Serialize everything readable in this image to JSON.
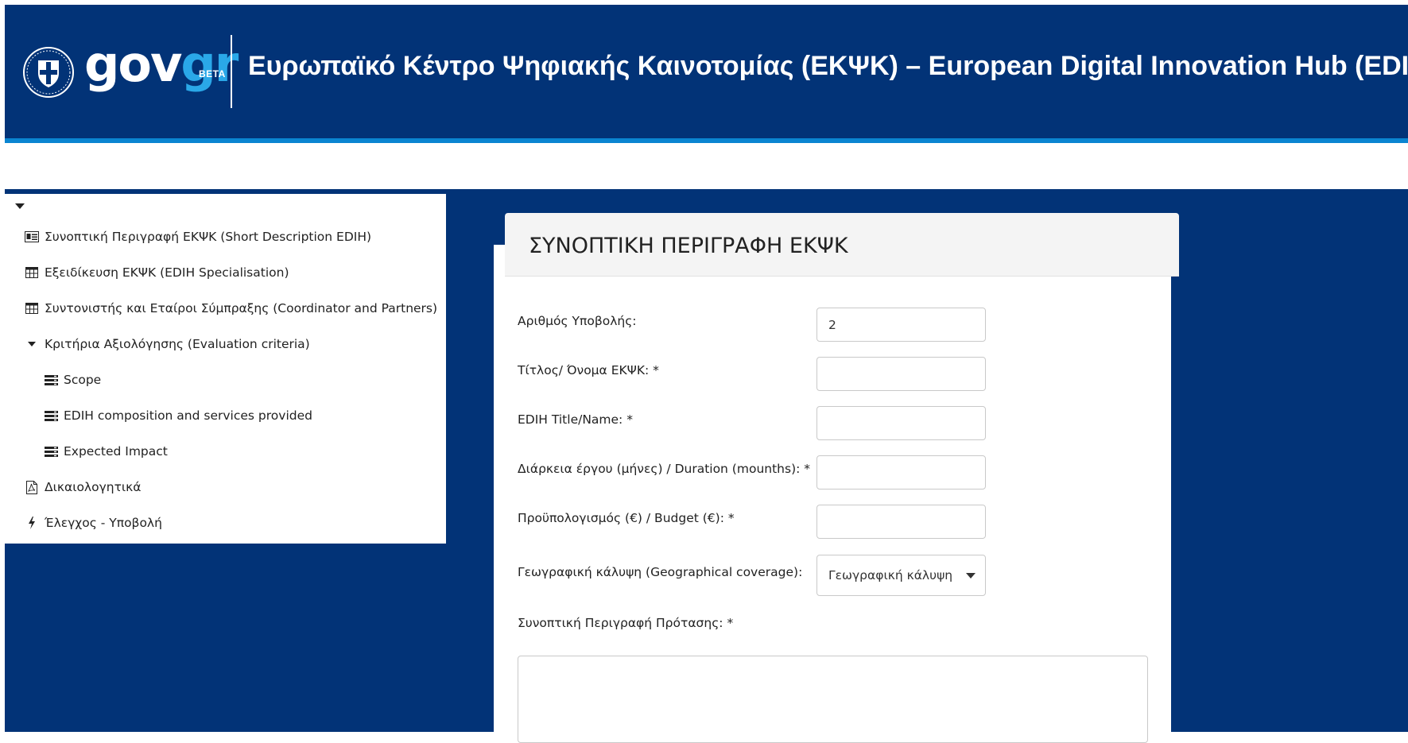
{
  "header": {
    "logo_gov": "gov",
    "logo_gr": "gr",
    "logo_beta": "BETA",
    "title": "Ευρωπαϊκό Κέντρο Ψηφιακής Καινοτομίας (ΕΚΨΚ) – European Digital Innovation Hub (EDIH)",
    "colors": {
      "background": "#023377",
      "accent_line": "#0a85d1",
      "logo_gr": "#2aa8e8"
    }
  },
  "sidebar": {
    "items": [
      {
        "label": "Συνοπτική Περιγραφή ΕΚΨΚ (Short Description EDIH)",
        "icon": "id-card-icon"
      },
      {
        "label": "Εξειδίκευση ΕΚΨΚ (EDIH Specialisation)",
        "icon": "table-icon"
      },
      {
        "label": "Συντονιστής και Εταίροι Σύμπραξης (Coordinator and Partners)",
        "icon": "table-icon"
      },
      {
        "label": "Κριτήρια Αξιολόγησης (Evaluation criteria)",
        "icon": "caret-down-icon"
      },
      {
        "label": "Scope",
        "icon": "list-icon"
      },
      {
        "label": "EDIH composition and services provided",
        "icon": "list-icon"
      },
      {
        "label": "Expected Impact",
        "icon": "list-icon"
      },
      {
        "label": "Δικαιολογητικά",
        "icon": "pdf-file-icon"
      },
      {
        "label": "Έλεγχος - Υποβολή",
        "icon": "bolt-icon"
      }
    ]
  },
  "form": {
    "title": "ΣΥΝΟΠΤΙΚΗ ΠΕΡΙΓΡΑΦΗ ΕΚΨΚ",
    "fields": [
      {
        "label": "Αριθμός Υποβολής:",
        "value": "2"
      },
      {
        "label": "Τίτλος/ Όνομα ΕΚΨΚ: *",
        "value": ""
      },
      {
        "label": "EDIH Title/Name: *",
        "value": ""
      },
      {
        "label": "Διάρκεια έργου (μήνες) / Duration (mounths): *",
        "value": ""
      },
      {
        "label": "Προϋπολογισμός (€) / Budget (€): *",
        "value": ""
      }
    ],
    "geo": {
      "label": "Γεωγραφική κάλυψη (Geographical coverage):",
      "selected": "Γεωγραφική κάλυψη"
    },
    "description": {
      "label": "Συνοπτική Περιγραφή Πρότασης: *",
      "value": ""
    }
  }
}
